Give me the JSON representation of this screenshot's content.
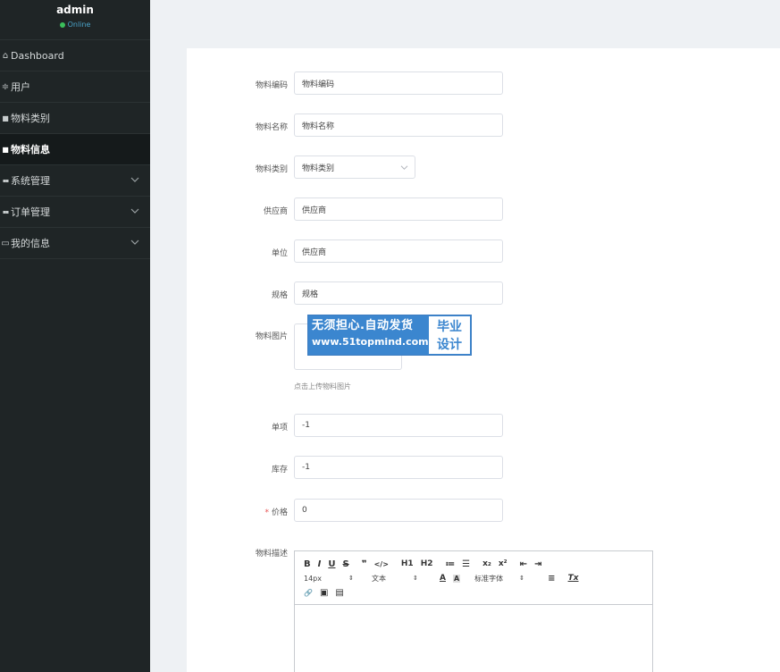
{
  "user": {
    "name": "admin",
    "status": "Online"
  },
  "menu": [
    {
      "label": "Dashboard",
      "icon": "home-icon",
      "glyph": "⌂"
    },
    {
      "label": "用户",
      "icon": "sliders-icon",
      "glyph": "≑"
    },
    {
      "label": "物料类别",
      "icon": "square-icon",
      "glyph": "■"
    },
    {
      "label": "物料信息",
      "icon": "square-icon",
      "glyph": "■"
    },
    {
      "label": "系统管理",
      "icon": "grid-icon",
      "glyph": "▪▪"
    },
    {
      "label": "订单管理",
      "icon": "grid-icon",
      "glyph": "▪▪"
    },
    {
      "label": "我的信息",
      "icon": "calendar-icon",
      "glyph": "▭"
    }
  ],
  "form": {
    "code": {
      "label": "物料编码",
      "placeholder": "物料编码"
    },
    "name": {
      "label": "物料名称",
      "placeholder": "物料名称"
    },
    "category": {
      "label": "物料类别",
      "placeholder": "物料类别"
    },
    "supplier": {
      "label": "供应商",
      "placeholder": "供应商"
    },
    "unit": {
      "label": "单位",
      "placeholder": "供应商"
    },
    "spec": {
      "label": "规格",
      "placeholder": "规格"
    },
    "image": {
      "label": "物料图片",
      "hint": "点击上传物料图片"
    },
    "unitvalue": {
      "label": "单项",
      "value": "-1"
    },
    "stock": {
      "label": "库存",
      "value": "-1"
    },
    "price": {
      "label": "价格",
      "required_mark": "*",
      "value": "0"
    },
    "desc": {
      "label": "物料描述"
    }
  },
  "watermark": {
    "line1": "无须担心.自动发货",
    "line2": "www.51topmind.com",
    "right1": "毕业",
    "right2": "设计"
  },
  "editor": {
    "row1": [
      "B",
      "I",
      "U",
      "S",
      "❞",
      "</>",
      "H1",
      "H2",
      "≔",
      "☰",
      "x₂",
      "x²",
      "⇤",
      "⇥"
    ],
    "font_size": "14px",
    "text_style": "文本",
    "font_family": "标准字体",
    "font_color_icon": "A",
    "bg_color_icon": "A",
    "align_icon": "≡",
    "clear_icon": "Tx",
    "link_icon": "🔗",
    "image_icon": "▣",
    "video_icon": "▤"
  },
  "colors": {
    "sidebar_bg": "#1f2526",
    "page_bg": "#eef1f4",
    "accent": "#3b86cf",
    "status_green": "#3bbf5b"
  }
}
